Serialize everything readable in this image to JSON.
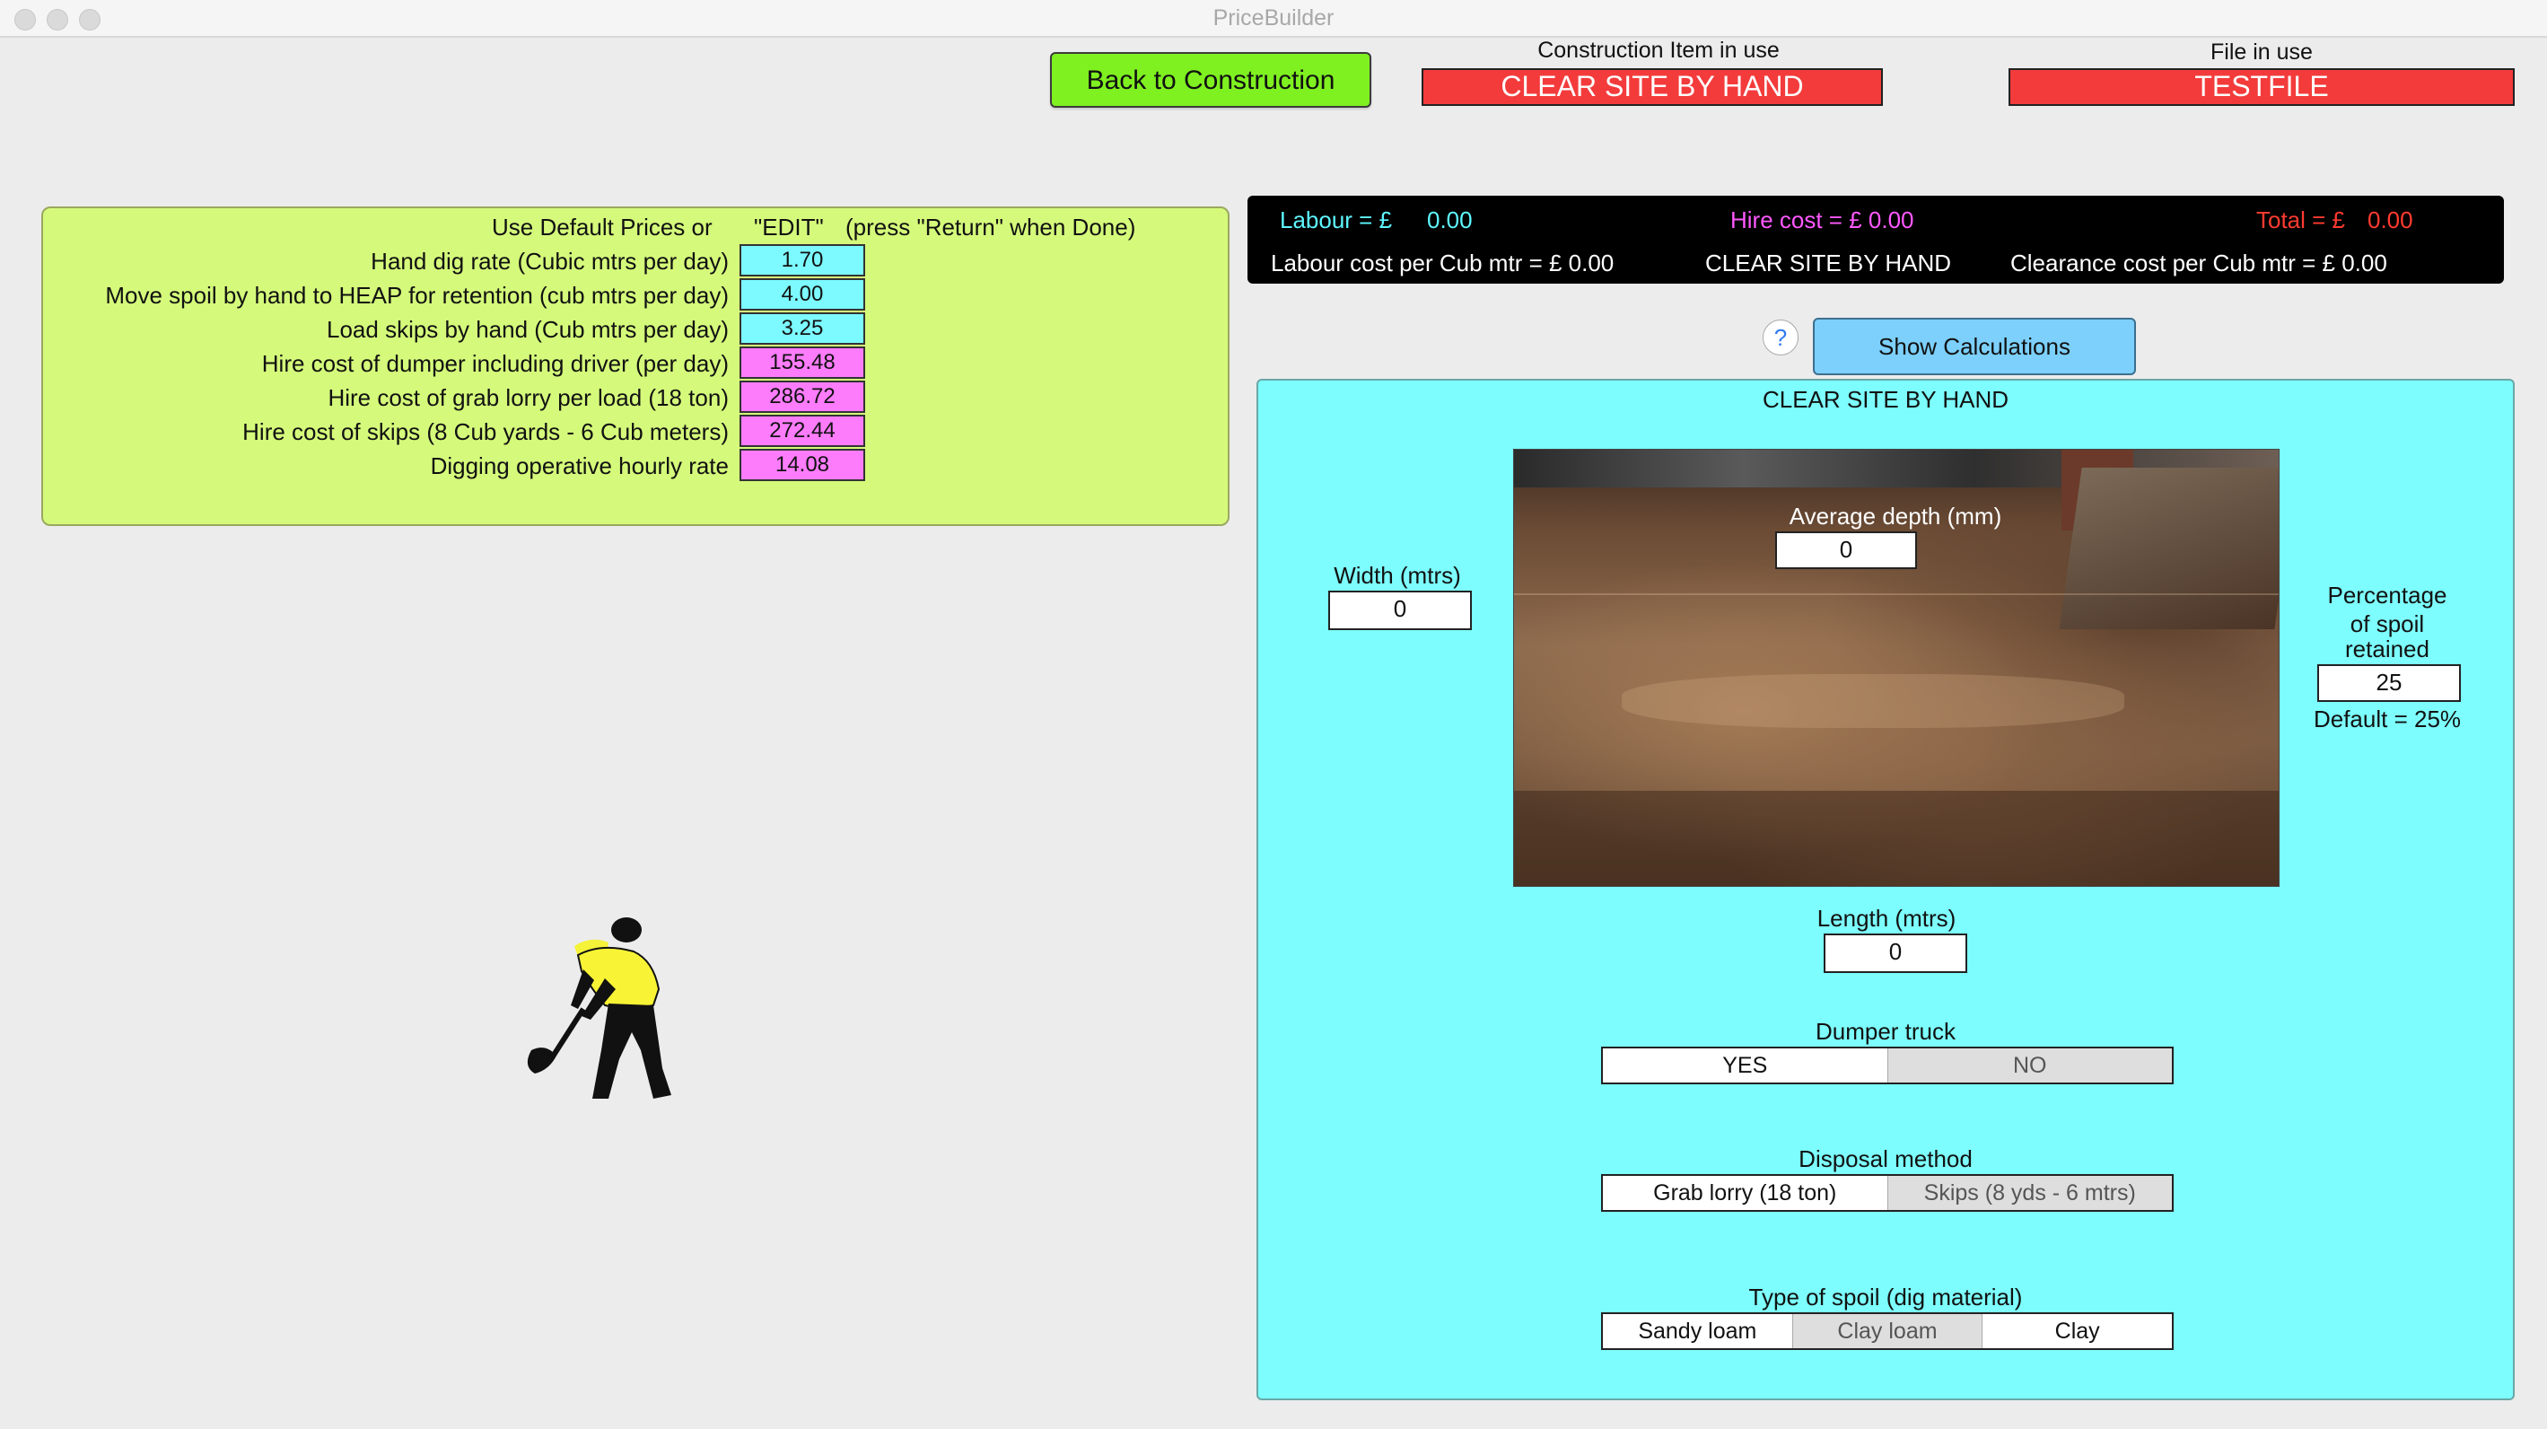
{
  "window": {
    "title": "PriceBuilder"
  },
  "header": {
    "back_button": "Back to Construction",
    "construction_label": "Construction Item in use",
    "construction_value": "CLEAR SITE BY HAND",
    "file_label": "File in use",
    "file_value": "TESTFILE"
  },
  "prices": {
    "header_text": "Use Default Prices or",
    "edit_text": "\"EDIT\"",
    "return_text": "(press \"Return\" when Done)",
    "rows": [
      {
        "label": "Hand dig rate (Cubic mtrs per day)",
        "value": "1.70"
      },
      {
        "label": "Move spoil by hand to HEAP for retention (cub mtrs per day)",
        "value": "4.00"
      },
      {
        "label": "Load skips by hand (Cub mtrs per day)",
        "value": "3.25"
      },
      {
        "label": "Hire cost of dumper including driver (per day)",
        "value": "155.48"
      },
      {
        "label": "Hire cost of grab lorry per load (18 ton)",
        "value": "286.72"
      },
      {
        "label": "Hire cost of skips (8 Cub yards - 6 Cub meters)",
        "value": "272.44"
      },
      {
        "label": "Digging operative hourly rate",
        "value": "14.08"
      }
    ]
  },
  "summary": {
    "labour_label": "Labour = £",
    "labour_value": "0.00",
    "hire_label": "Hire cost = £ 0.00",
    "total_label": "Total = £",
    "total_value": "0.00",
    "labour_per_cub": "Labour cost per Cub mtr = £  0.00",
    "item_name": "CLEAR SITE BY HAND",
    "clearance_per_cub": "Clearance cost per Cub mtr = £  0.00",
    "colors": {
      "labour": "#5ef7ff",
      "hire": "#ff59ff",
      "total": "#ff3b30"
    }
  },
  "calc": {
    "help": "?",
    "show_button": "Show Calculations"
  },
  "main": {
    "title": "CLEAR SITE BY HAND",
    "avg_depth_label": "Average depth (mm)",
    "avg_depth_value": "0",
    "width_label": "Width (mtrs)",
    "width_value": "0",
    "length_label": "Length (mtrs)",
    "length_value": "0",
    "spoil_label_1": "Percentage",
    "spoil_label_2": "of spoil",
    "spoil_label_3": "retained",
    "spoil_value": "25",
    "spoil_default": "Default = 25%",
    "dumper": {
      "label": "Dumper truck",
      "options": [
        "YES",
        "NO"
      ]
    },
    "disposal": {
      "label": "Disposal method",
      "options": [
        "Grab lorry (18 ton)",
        "Skips (8 yds - 6 mtrs)"
      ]
    },
    "spoil_type": {
      "label": "Type of spoil (dig material)",
      "options": [
        "Sandy loam",
        "Clay loam",
        "Clay"
      ]
    }
  }
}
